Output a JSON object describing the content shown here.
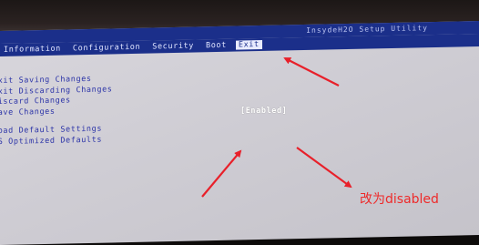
{
  "bios": {
    "title": "InsydeH2O Setup Utility",
    "menu": [
      "Information",
      "Configuration",
      "Security",
      "Boot",
      "Exit"
    ],
    "active_menu": "Exit",
    "options": [
      "Exit Saving Changes",
      "Exit Discarding Changes",
      "Discard Changes",
      "Save Changes",
      "Load Default Settings",
      "OS Optimized Defaults"
    ],
    "selected_value": "[Enabled]"
  },
  "annotation": {
    "text": "改为disabled",
    "color": "#ee2a2a"
  },
  "colors": {
    "menu_bar": "#1b2f8a",
    "option_text": "#2d35a8",
    "screen": "#d8d6dc"
  }
}
